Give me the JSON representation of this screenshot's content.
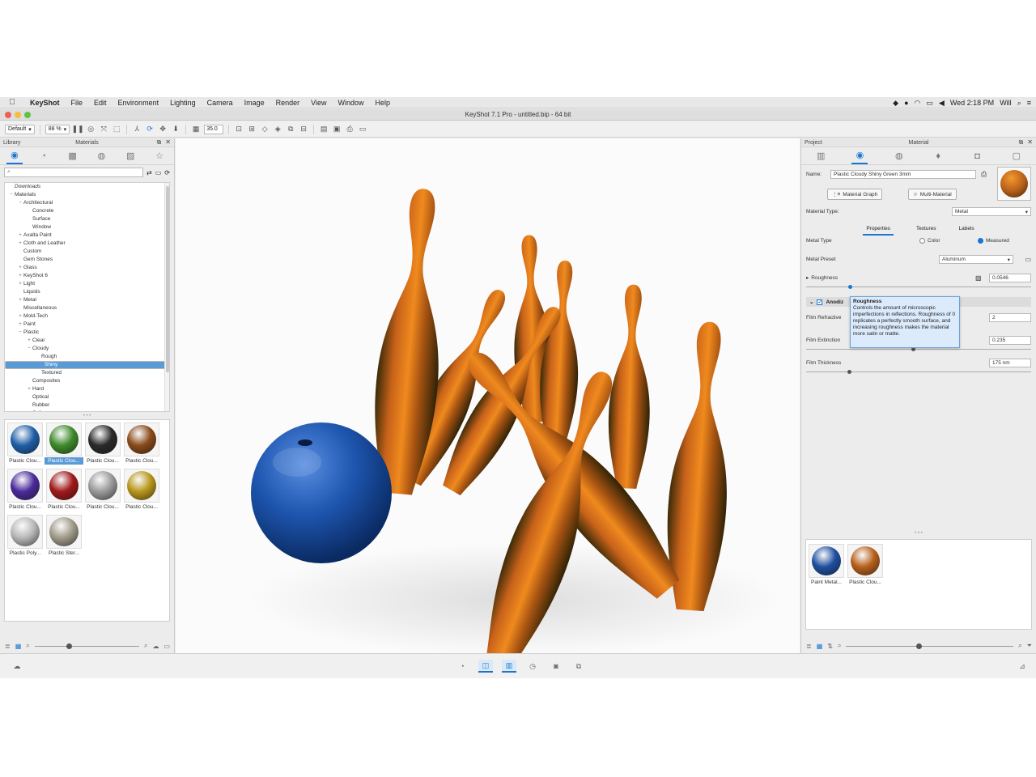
{
  "menubar": {
    "app": "KeyShot",
    "items": [
      "File",
      "Edit",
      "Environment",
      "Lighting",
      "Camera",
      "Image",
      "Render",
      "View",
      "Window",
      "Help"
    ],
    "clock": "Wed 2:18 PM",
    "user": "Will"
  },
  "window": {
    "title": "KeyShot 7.1 Pro  - untitled.bip  - 64 bit"
  },
  "toolbar": {
    "preset": "Default",
    "zoom": "88 %",
    "fov": "35.0"
  },
  "left_panel": {
    "header_left": "Library",
    "header_center": "Materials",
    "search_placeholder": "",
    "tree": [
      {
        "label": "Downloads",
        "depth": 0,
        "exp": ""
      },
      {
        "label": "Materials",
        "depth": 0,
        "exp": "−"
      },
      {
        "label": "Architectural",
        "depth": 1,
        "exp": "−"
      },
      {
        "label": "Concrete",
        "depth": 2,
        "exp": ""
      },
      {
        "label": "Surface",
        "depth": 2,
        "exp": ""
      },
      {
        "label": "Window",
        "depth": 2,
        "exp": ""
      },
      {
        "label": "Axalta Paint",
        "depth": 1,
        "exp": "+"
      },
      {
        "label": "Cloth and Leather",
        "depth": 1,
        "exp": "+"
      },
      {
        "label": "Custom",
        "depth": 1,
        "exp": ""
      },
      {
        "label": "Gem Stones",
        "depth": 1,
        "exp": ""
      },
      {
        "label": "Glass",
        "depth": 1,
        "exp": "+"
      },
      {
        "label": "KeyShot 6",
        "depth": 1,
        "exp": "+"
      },
      {
        "label": "Light",
        "depth": 1,
        "exp": "+"
      },
      {
        "label": "Liquids",
        "depth": 1,
        "exp": ""
      },
      {
        "label": "Metal",
        "depth": 1,
        "exp": "+"
      },
      {
        "label": "Miscellaneous",
        "depth": 1,
        "exp": ""
      },
      {
        "label": "Mold-Tech",
        "depth": 1,
        "exp": "+"
      },
      {
        "label": "Paint",
        "depth": 1,
        "exp": "+"
      },
      {
        "label": "Plastic",
        "depth": 1,
        "exp": "−"
      },
      {
        "label": "Clear",
        "depth": 2,
        "exp": "+"
      },
      {
        "label": "Cloudy",
        "depth": 2,
        "exp": "−"
      },
      {
        "label": "Rough",
        "depth": 3,
        "exp": ""
      },
      {
        "label": "Shiny",
        "depth": 3,
        "exp": "",
        "selected": true
      },
      {
        "label": "Textured",
        "depth": 3,
        "exp": ""
      },
      {
        "label": "Composites",
        "depth": 2,
        "exp": ""
      },
      {
        "label": "Hard",
        "depth": 2,
        "exp": "+"
      },
      {
        "label": "Optical",
        "depth": 2,
        "exp": ""
      },
      {
        "label": "Rubber",
        "depth": 2,
        "exp": ""
      },
      {
        "label": "Soft",
        "depth": 2,
        "exp": "+"
      }
    ],
    "thumbs": [
      {
        "label": "Plastic Clou...",
        "color": "#1f5fa8"
      },
      {
        "label": "Plastic Clou...",
        "color": "#3f8a2a",
        "active": true
      },
      {
        "label": "Plastic Clou...",
        "color": "#2a2a2a"
      },
      {
        "label": "Plastic Clou...",
        "color": "#8a4a1a"
      },
      {
        "label": "Plastic Clou...",
        "color": "#4a2a9a"
      },
      {
        "label": "Plastic Clou...",
        "color": "#a01818"
      },
      {
        "label": "Plastic Clou...",
        "color": "#9a9a9a"
      },
      {
        "label": "Plastic Clou...",
        "color": "#b8961a"
      },
      {
        "label": "Plastic Poly...",
        "color": "#b8b8b8"
      },
      {
        "label": "Plastic Ster...",
        "color": "#a09a88"
      }
    ]
  },
  "right_panel": {
    "header_left": "Project",
    "header_center": "Material",
    "name_label": "Name:",
    "name_value": "Plastic Cloudy Shiny Green 3mm",
    "material_graph": "Material Graph",
    "multi_material": "Multi-Material",
    "type_label": "Material Type:",
    "type_value": "Metal",
    "tabs": [
      "Properties",
      "Textures",
      "Labels"
    ],
    "metal_type_label": "Metal Type",
    "radio_color": "Color",
    "radio_measured": "Measured",
    "preset_label": "Metal Preset",
    "preset_value": "Aluminum",
    "roughness_label": "Roughness",
    "roughness_value": "0.0546",
    "section_label": "Anodiz",
    "film_ri_label": "Film Refractive",
    "film_ri_value": "2",
    "film_ext_label": "Film Extinction",
    "film_ext_value": "0.235",
    "film_thick_label": "Film Thickness",
    "film_thick_value": "175 nm",
    "tooltip_title": "Roughness",
    "tooltip_body": "Controls the amount of microscopic imperfections in reflections. Roughness of 0 replicates a perfectly smooth surface, and increasing roughness makes the material more satin or matte.",
    "project_thumbs": [
      {
        "label": "Paint Metal...",
        "color": "#1f4fa0"
      },
      {
        "label": "Plastic Clou...",
        "color": "#b8601a"
      }
    ]
  },
  "colors": {
    "accent": "#1976d2",
    "pin": "#c7621a",
    "ball": "#1e56b0"
  }
}
